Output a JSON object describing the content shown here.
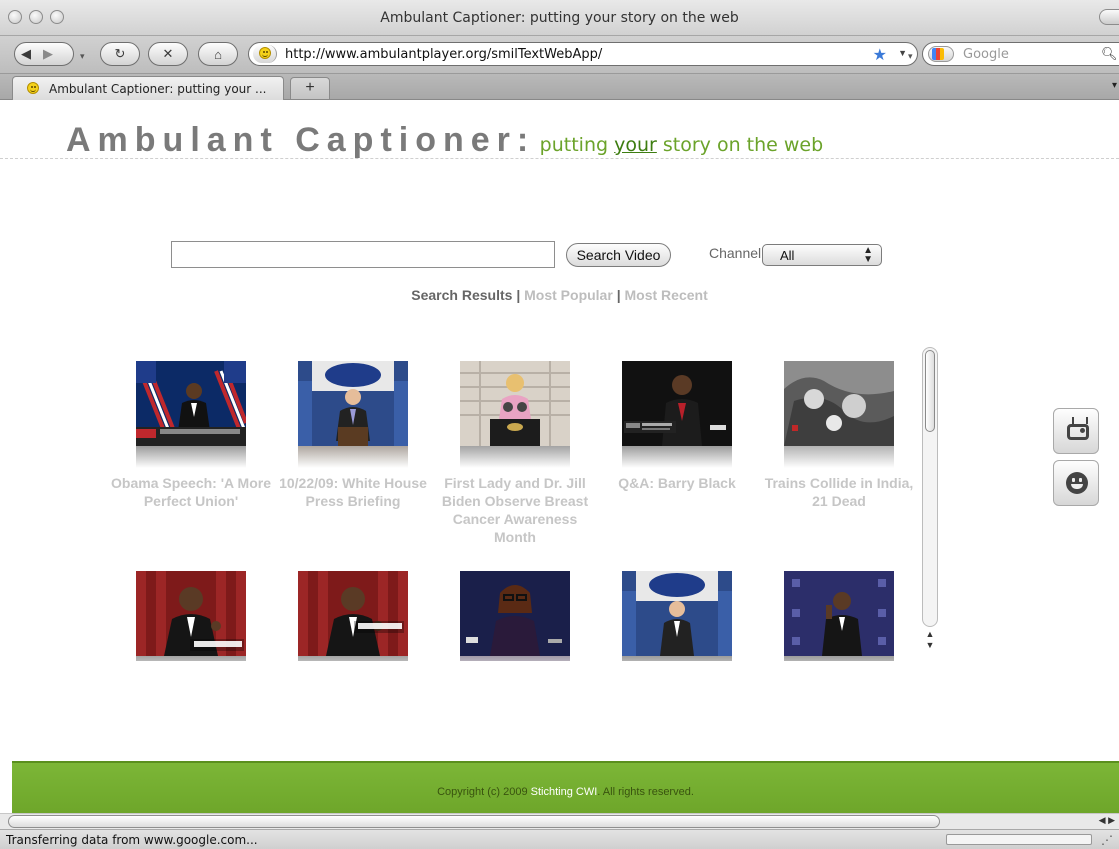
{
  "window": {
    "title": "Ambulant Captioner: putting your story on the web"
  },
  "toolbar": {
    "url": "http://www.ambulantplayer.org/smilTextWebApp/",
    "search_placeholder": "Google"
  },
  "tabs": [
    {
      "label": "Ambulant Captioner: putting your ..."
    }
  ],
  "site": {
    "title": "Ambulant Captioner:",
    "tagline_before": "putting ",
    "tagline_emph": "your",
    "tagline_after": " story on the web"
  },
  "search": {
    "query": "",
    "button_label": "Search Video",
    "channel_label": "Channel:",
    "channel_value": "All"
  },
  "filters": {
    "results": "Search Results",
    "separator": "|",
    "popular": "Most Popular",
    "recent": "Most Recent"
  },
  "videos": [
    {
      "caption": "Obama Speech: 'A More Perfect Union'"
    },
    {
      "caption": "10/22/09: White House Press Briefing"
    },
    {
      "caption": "First Lady and Dr. Jill Biden Observe Breast Cancer Awareness Month"
    },
    {
      "caption": "Q&A: Barry Black"
    },
    {
      "caption": "Trains Collide in India, 21 Dead"
    },
    {
      "caption": ""
    },
    {
      "caption": ""
    },
    {
      "caption": ""
    },
    {
      "caption": ""
    },
    {
      "caption": ""
    }
  ],
  "footer": {
    "prefix": "Copyright (c) 2009 ",
    "link": "Stichting CWI",
    "suffix": ". All rights reserved."
  },
  "status": {
    "text": "Transferring data from www.google.com..."
  },
  "colors": {
    "accent_green": "#6ea62a",
    "tagline_green": "#6ba32a"
  }
}
